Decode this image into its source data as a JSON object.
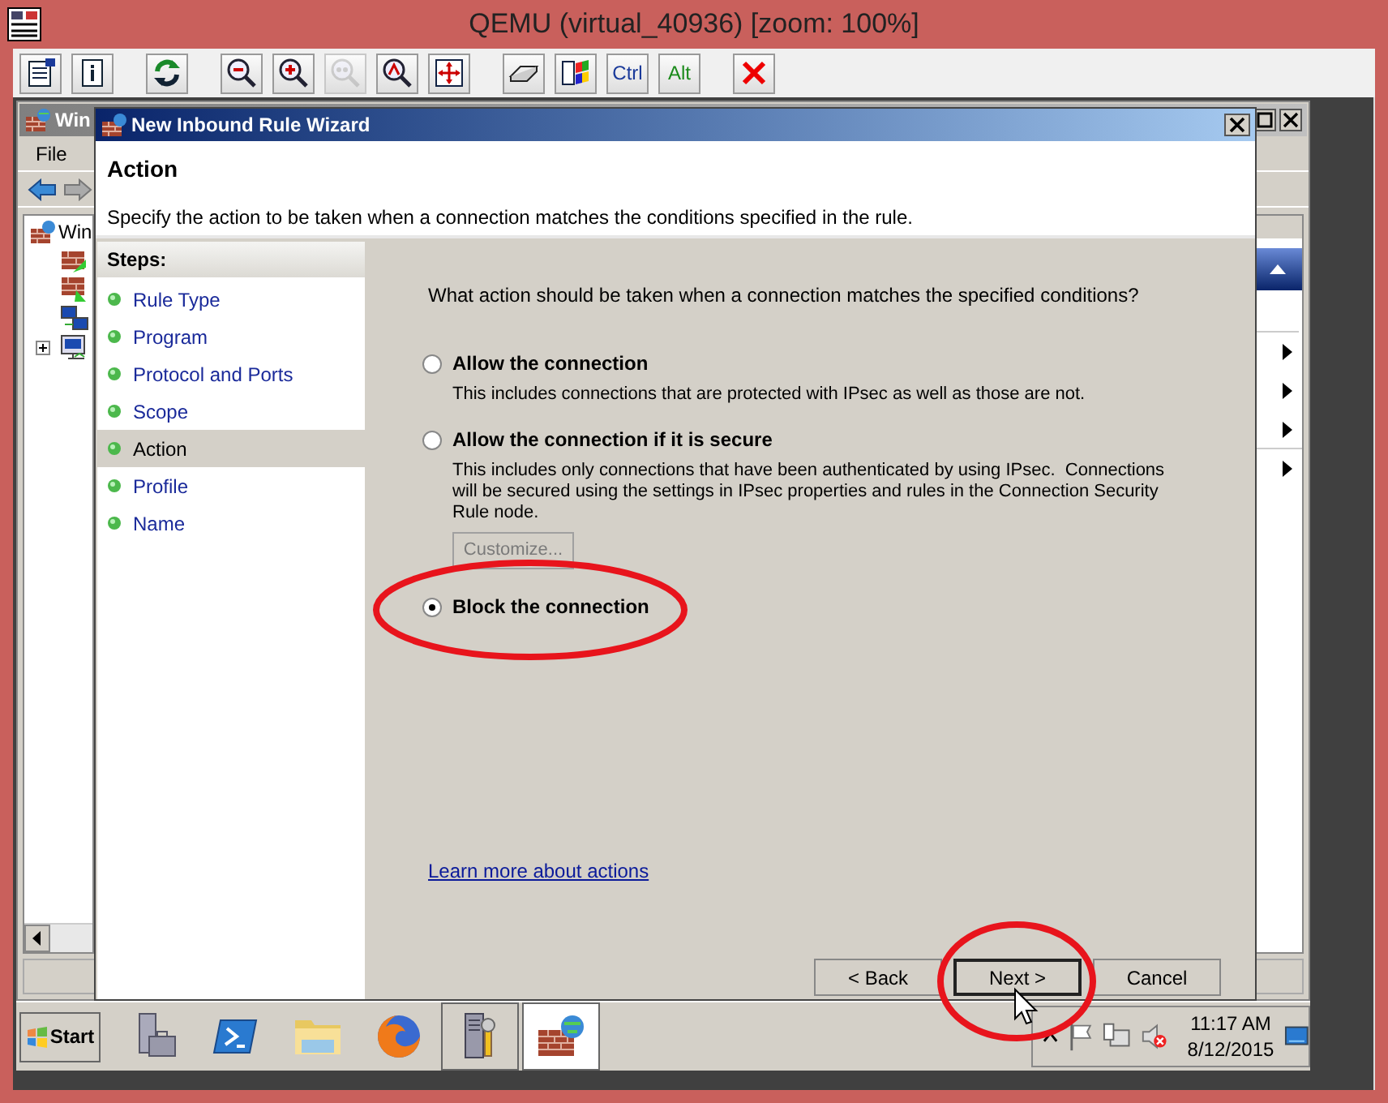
{
  "window": {
    "title": "QEMU (virtual_40936) [zoom: 100%]"
  },
  "toolbar": {
    "groups": [
      {
        "buttons": [
          {
            "kind": "icon",
            "disabled": false
          },
          {
            "kind": "icon",
            "disabled": false
          }
        ]
      },
      {
        "buttons": [
          {
            "kind": "icon",
            "disabled": false
          }
        ]
      },
      {
        "buttons": [
          {
            "kind": "icon",
            "disabled": false
          },
          {
            "kind": "icon",
            "disabled": false
          },
          {
            "kind": "icon",
            "disabled": true
          },
          {
            "kind": "icon",
            "disabled": false
          },
          {
            "kind": "icon",
            "disabled": false
          }
        ]
      },
      {
        "buttons": [
          {
            "kind": "icon",
            "disabled": false
          },
          {
            "kind": "icon",
            "disabled": false
          },
          {
            "kind": "text",
            "label": "Ctrl"
          },
          {
            "kind": "text",
            "label": "Alt"
          }
        ]
      },
      {
        "buttons": [
          {
            "kind": "icon",
            "disabled": false
          }
        ]
      }
    ]
  },
  "background_window": {
    "title": "Win",
    "menu": [
      {
        "label": "File"
      }
    ],
    "tree": [
      {
        "label": "Win",
        "children": [
          {
            "has_children": false
          },
          {
            "has_children": false
          },
          {
            "has_children": false
          },
          {
            "has_children": true
          }
        ]
      }
    ]
  },
  "wizard": {
    "title": "New Inbound Rule Wizard",
    "heading": "Action",
    "description": "Specify the action to be taken when a connection matches the conditions specified in the rule.",
    "steps_title": "Steps:",
    "steps": [
      {
        "label": "Rule Type",
        "selected": false
      },
      {
        "label": "Program",
        "selected": false
      },
      {
        "label": "Protocol and Ports",
        "selected": false
      },
      {
        "label": "Scope",
        "selected": false
      },
      {
        "label": "Action",
        "selected": true
      },
      {
        "label": "Profile",
        "selected": false
      },
      {
        "label": "Name",
        "selected": false
      }
    ],
    "question": "What action should be taken when a connection matches the specified conditions?",
    "options": [
      {
        "label": "Allow the connection",
        "description": "This includes connections that are protected with IPsec as well as those are not.",
        "selected": false
      },
      {
        "label": "Allow the connection if it is secure",
        "description": "This includes only connections that have been authenticated by using IPsec.  Connections will be secured using the settings in IPsec properties and rules in the Connection Security Rule node.",
        "selected": false,
        "customize": {
          "label": "Customize...",
          "disabled": true
        }
      },
      {
        "label": "Block the connection",
        "selected": true
      }
    ],
    "link": "Learn more about actions",
    "buttons": [
      {
        "label": "< Back",
        "default": false
      },
      {
        "label": "Next >",
        "default": true
      },
      {
        "label": "Cancel",
        "default": false
      }
    ]
  },
  "taskbar": {
    "start": "Start",
    "apps": [
      {
        "open": false,
        "selected": false
      },
      {
        "open": false,
        "selected": false
      },
      {
        "open": false,
        "selected": false
      },
      {
        "open": false,
        "selected": false
      },
      {
        "open": true,
        "selected": false
      },
      {
        "open": true,
        "selected": true
      }
    ],
    "clock": {
      "time": "11:17 AM",
      "date": "8/12/2015"
    }
  }
}
